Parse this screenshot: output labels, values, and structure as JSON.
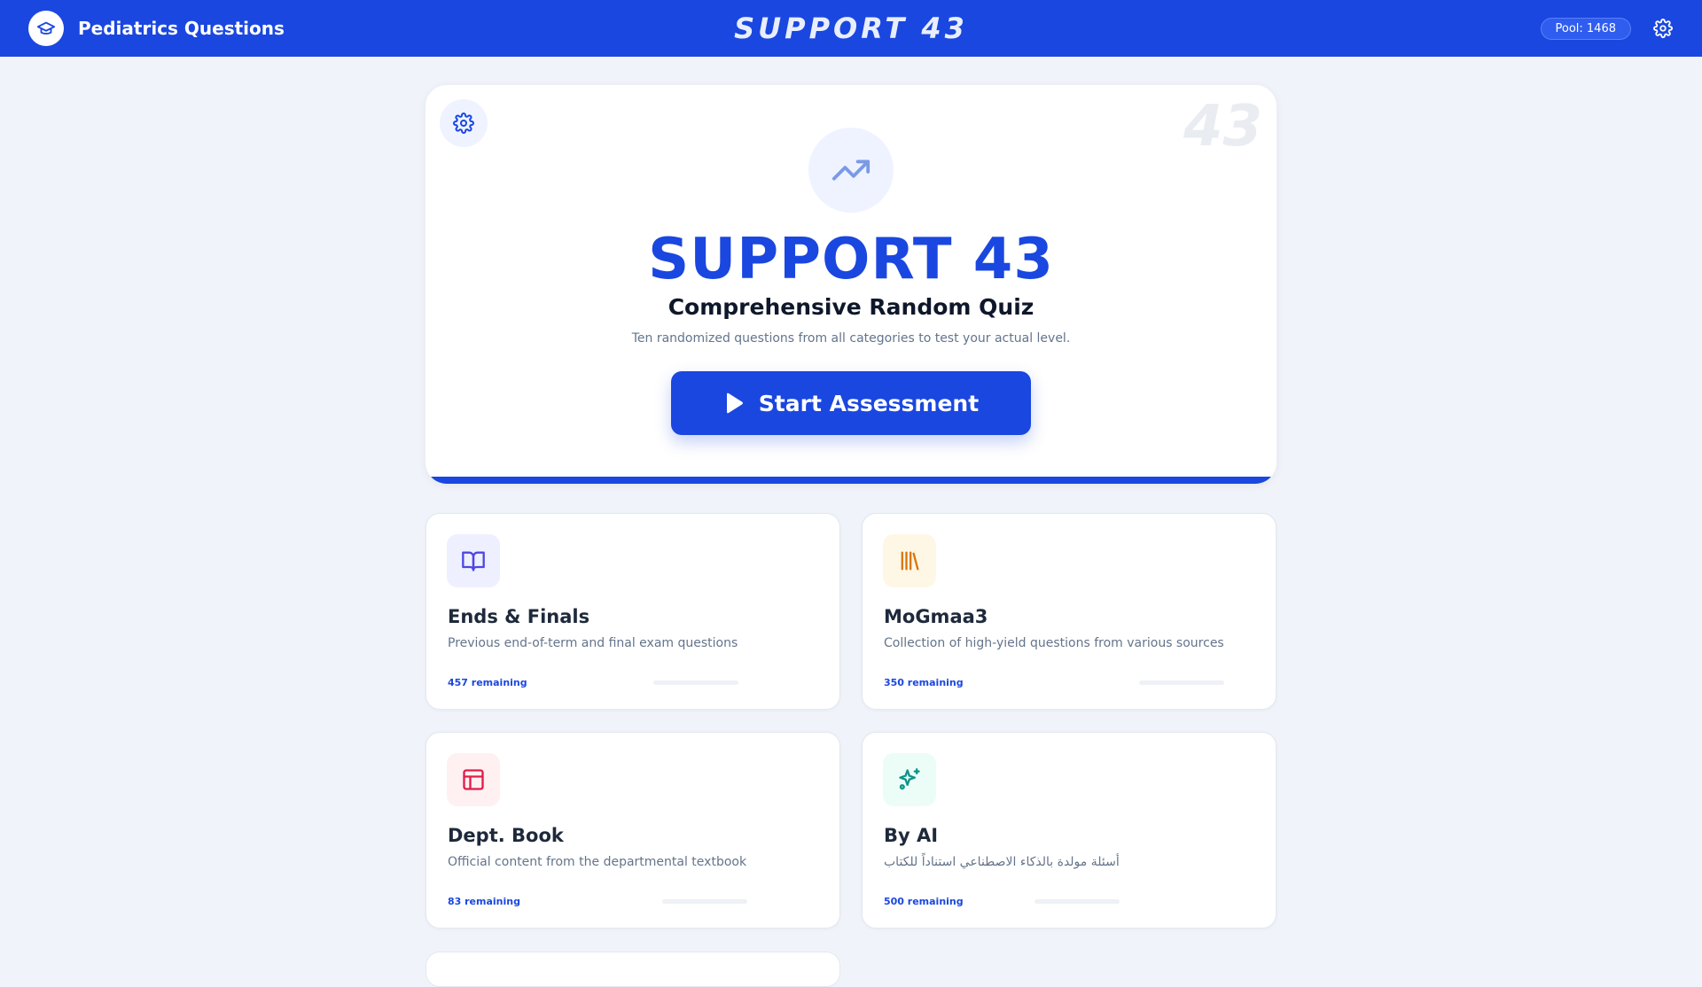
{
  "header": {
    "title": "Pediatrics Questions",
    "center_title": "SUPPORT 43",
    "pool_badge": "Pool: 1468"
  },
  "hero": {
    "watermark": "43",
    "title": "SUPPORT 43",
    "subtitle": "Comprehensive Random Quiz",
    "description": "Ten randomized questions from all categories to test your actual level.",
    "start_label": "Start Assessment"
  },
  "categories": [
    {
      "name": "Ends & Finals",
      "description": "Previous end-of-term and final exam questions",
      "remaining": "457 remaining",
      "icon": "book-open-icon",
      "color": "#4f46e5",
      "icon_bg": "#eef0ff"
    },
    {
      "name": "MoGmaa3",
      "description": "Collection of high-yield questions from various sources",
      "remaining": "350 remaining",
      "icon": "library-icon",
      "color": "#d97706",
      "icon_bg": "#fff7e6"
    },
    {
      "name": "Dept. Book",
      "description": "Official content from the departmental textbook",
      "remaining": "83 remaining",
      "icon": "layout-icon",
      "color": "#e11d48",
      "icon_bg": "#fff0f2"
    },
    {
      "name": "By AI",
      "description": "أسئلة مولدة بالذكاء الاصطناعي استناداً للكتاب",
      "remaining": "500 remaining",
      "icon": "sparkles-icon",
      "color": "#0d9488",
      "icon_bg": "#ecfdf8"
    }
  ],
  "colors": {
    "primary": "#1a47e0",
    "background": "#f0f4fa"
  }
}
